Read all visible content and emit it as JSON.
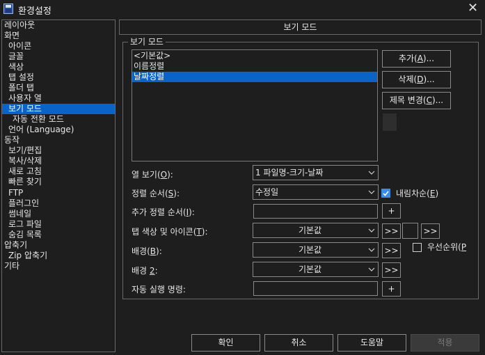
{
  "window": {
    "title": "환경설정",
    "close": "✕"
  },
  "tree": {
    "items": [
      {
        "label": "레이아웃"
      },
      {
        "label": "화면"
      },
      {
        "label": "아이콘"
      },
      {
        "label": "글꼴"
      },
      {
        "label": "색상"
      },
      {
        "label": "탭 설정"
      },
      {
        "label": "폴더 탭"
      },
      {
        "label": "사용자 열"
      },
      {
        "label": "보기 모드",
        "selected": true
      },
      {
        "label": "자동 전환 모드"
      },
      {
        "label": "언어 (Language)"
      },
      {
        "label": "동작"
      },
      {
        "label": "보기/편집"
      },
      {
        "label": "복사/삭제"
      },
      {
        "label": "새로 고침"
      },
      {
        "label": "빠른 찾기"
      },
      {
        "label": "FTP"
      },
      {
        "label": "플러그인"
      },
      {
        "label": "썸네일"
      },
      {
        "label": "로그 파일"
      },
      {
        "label": "숨김 목록"
      },
      {
        "label": "압축기"
      },
      {
        "label": "Zip 압축기"
      },
      {
        "label": "기타"
      }
    ]
  },
  "panel": {
    "header": "보기 모드",
    "group_title": "보기 모드",
    "modes": [
      "<기본값>",
      "이름정렬",
      "날짜정렬"
    ],
    "selected_mode": "날짜정렬",
    "buttons": {
      "add": {
        "text": "추가",
        "key": "A",
        "suffix": "..."
      },
      "delete": {
        "text": "삭제",
        "key": "D",
        "suffix": "..."
      },
      "rename": {
        "text": "제목 변경",
        "key": "C",
        "suffix": "..."
      }
    },
    "fields": {
      "columns": {
        "label": "열 보기",
        "key": "O",
        "value": "1 파일명-크기-날짜"
      },
      "sort_order": {
        "label": "정렬 순서",
        "key": "S",
        "value": "수정일"
      },
      "descending": {
        "label": "내림차순",
        "key": "E",
        "checked": true
      },
      "extra_sort": {
        "label": "추가 정렬 순서",
        "key": "I",
        "value": ""
      },
      "tab_color_icon": {
        "label": "탭 색상 및 아이콘",
        "key": "T",
        "value": "기본값"
      },
      "background": {
        "label": "배경",
        "key": "B",
        "value": "기본값"
      },
      "priority": {
        "label": "우선순위",
        "key": "P",
        "checked": false
      },
      "background2": {
        "label": "배경",
        "key": "2",
        "value": "기본값"
      },
      "auto_command": {
        "label": "자동 실행 명령:",
        "value": ""
      }
    },
    "plus": "+",
    "more": ">>"
  },
  "footer": {
    "ok": "확인",
    "cancel": "취소",
    "help": "도움말",
    "apply": "적용"
  },
  "colors": {
    "background": "#1e1e1e",
    "selection": "#0a64c8",
    "border": "#8a8a8a",
    "checkbox_checked": "#3a8ce6"
  }
}
